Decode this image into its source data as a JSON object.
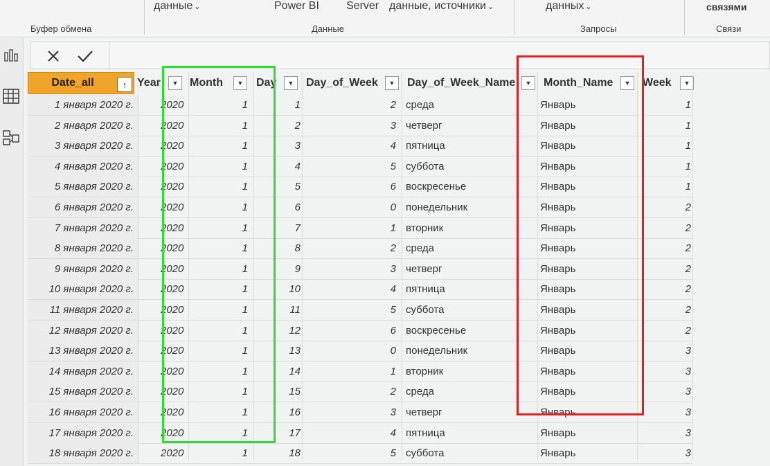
{
  "ribbon": {
    "items": [
      {
        "label": "данные",
        "chevron": true
      },
      {
        "label": "Power BI",
        "chevron": false
      },
      {
        "label": "Server",
        "chevron": false
      },
      {
        "label": "данные, источники",
        "chevron": true
      },
      {
        "label": "данных",
        "chevron": true
      },
      {
        "label": "связями",
        "chevron": false
      }
    ],
    "groups": [
      "Буфер обмена",
      "Данные",
      "Запросы",
      "Связи"
    ]
  },
  "formula_bar": {
    "cancel_icon": "close-icon",
    "commit_icon": "check-icon"
  },
  "rail_icons": [
    "report-view-icon",
    "data-view-icon",
    "model-view-icon"
  ],
  "table": {
    "headers": {
      "date": "Date_all",
      "year": "Year",
      "month": "Month",
      "day": "Day",
      "dow": "Day_of_Week",
      "downame": "Day_of_Week_Name",
      "mname": "Month_Name",
      "week": "Week"
    },
    "rows": [
      {
        "date": "1 января 2020 г.",
        "year": "2020",
        "month": "1",
        "day": "1",
        "dow": "2",
        "downame": "среда",
        "mname": "Январь",
        "week": "1"
      },
      {
        "date": "2 января 2020 г.",
        "year": "2020",
        "month": "1",
        "day": "2",
        "dow": "3",
        "downame": "четверг",
        "mname": "Январь",
        "week": "1"
      },
      {
        "date": "3 января 2020 г.",
        "year": "2020",
        "month": "1",
        "day": "3",
        "dow": "4",
        "downame": "пятница",
        "mname": "Январь",
        "week": "1"
      },
      {
        "date": "4 января 2020 г.",
        "year": "2020",
        "month": "1",
        "day": "4",
        "dow": "5",
        "downame": "суббота",
        "mname": "Январь",
        "week": "1"
      },
      {
        "date": "5 января 2020 г.",
        "year": "2020",
        "month": "1",
        "day": "5",
        "dow": "6",
        "downame": "воскресенье",
        "mname": "Январь",
        "week": "1"
      },
      {
        "date": "6 января 2020 г.",
        "year": "2020",
        "month": "1",
        "day": "6",
        "dow": "0",
        "downame": "понедельник",
        "mname": "Январь",
        "week": "2"
      },
      {
        "date": "7 января 2020 г.",
        "year": "2020",
        "month": "1",
        "day": "7",
        "dow": "1",
        "downame": "вторник",
        "mname": "Январь",
        "week": "2"
      },
      {
        "date": "8 января 2020 г.",
        "year": "2020",
        "month": "1",
        "day": "8",
        "dow": "2",
        "downame": "среда",
        "mname": "Январь",
        "week": "2"
      },
      {
        "date": "9 января 2020 г.",
        "year": "2020",
        "month": "1",
        "day": "9",
        "dow": "3",
        "downame": "четверг",
        "mname": "Январь",
        "week": "2"
      },
      {
        "date": "10 января 2020 г.",
        "year": "2020",
        "month": "1",
        "day": "10",
        "dow": "4",
        "downame": "пятница",
        "mname": "Январь",
        "week": "2"
      },
      {
        "date": "11 января 2020 г.",
        "year": "2020",
        "month": "1",
        "day": "11",
        "dow": "5",
        "downame": "суббота",
        "mname": "Январь",
        "week": "2"
      },
      {
        "date": "12 января 2020 г.",
        "year": "2020",
        "month": "1",
        "day": "12",
        "dow": "6",
        "downame": "воскресенье",
        "mname": "Январь",
        "week": "2"
      },
      {
        "date": "13 января 2020 г.",
        "year": "2020",
        "month": "1",
        "day": "13",
        "dow": "0",
        "downame": "понедельник",
        "mname": "Январь",
        "week": "3"
      },
      {
        "date": "14 января 2020 г.",
        "year": "2020",
        "month": "1",
        "day": "14",
        "dow": "1",
        "downame": "вторник",
        "mname": "Январь",
        "week": "3"
      },
      {
        "date": "15 января 2020 г.",
        "year": "2020",
        "month": "1",
        "day": "15",
        "dow": "2",
        "downame": "среда",
        "mname": "Январь",
        "week": "3"
      },
      {
        "date": "16 января 2020 г.",
        "year": "2020",
        "month": "1",
        "day": "16",
        "dow": "3",
        "downame": "четверг",
        "mname": "Январь",
        "week": "3"
      },
      {
        "date": "17 января 2020 г.",
        "year": "2020",
        "month": "1",
        "day": "17",
        "dow": "4",
        "downame": "пятница",
        "mname": "Январь",
        "week": "3"
      },
      {
        "date": "18 января 2020 г.",
        "year": "2020",
        "month": "1",
        "day": "18",
        "dow": "5",
        "downame": "суббота",
        "mname": "Январь",
        "week": "3"
      }
    ]
  },
  "highlights": {
    "month_column_color": "#2fdc2f",
    "month_name_column_color": "#e02020"
  }
}
